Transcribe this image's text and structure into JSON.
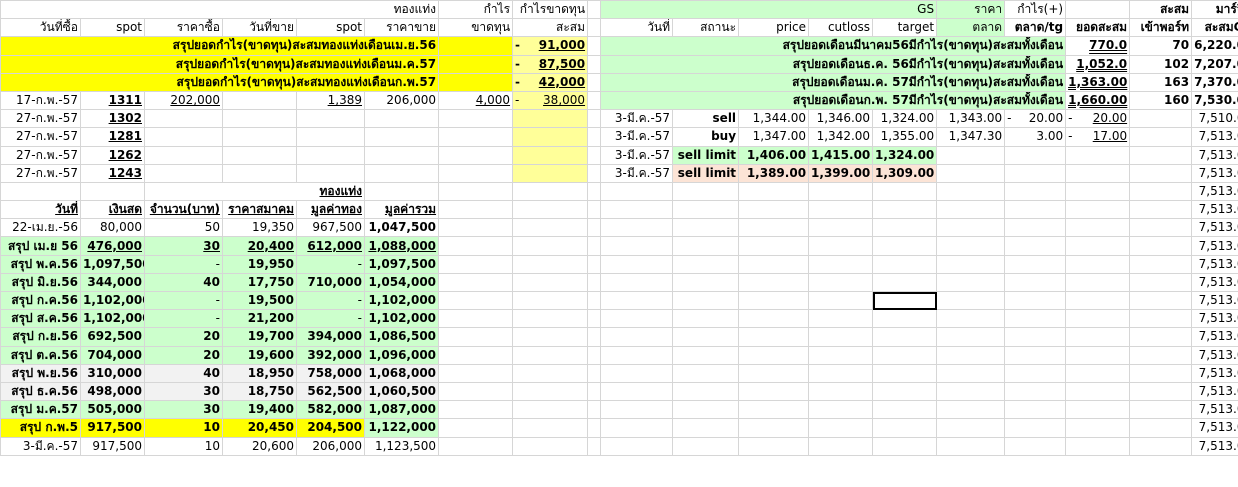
{
  "header1": {
    "gold": "ทองแท่ง",
    "profit": "กำไร",
    "profit_loss": "กำไรขาดทุน",
    "gs": "GS",
    "price": "ราคา",
    "profit_plus": "กำไร(+)",
    "accum": "สะสม",
    "margin": "มาร์จิ้น"
  },
  "header2": {
    "buy_date": "วันที่ซื้อ",
    "spot": "spot",
    "buy_price": "ราคาซื้อ",
    "sell_date": "วันที่ขาย",
    "spot2": "spot",
    "sell_price": "ราคาขาย",
    "loss": "ขาดทุน",
    "accum": "สะสม",
    "date": "วันที่",
    "status": "สถานะ",
    "price": "price",
    "cutloss": "cutloss",
    "target": "target",
    "market": "ตลาด",
    "market_tg": "ตลาด/tg",
    "total_accum": "ยอดสะสม",
    "port": "เข้าพอร์ท",
    "accum_gs": "สะสมGS"
  },
  "summary_rows": [
    {
      "label": "สรุปยอดกำไร(ขาดทุน)สะสมทองแท่งเดือนเม.ย.56",
      "dash": "-",
      "value": "91,000",
      "gs_label": "สรุปยอดเดือนมีนาคม56มีกำไร(ขาดทุน)สะสมทั้งเดือน",
      "gs_total": "770.0",
      "port": "70",
      "gs_accum": "6,220.00"
    },
    {
      "label": "สรุปยอดกำไร(ขาดทุน)สะสมทองแท่งเดือนม.ค.57",
      "dash": "-",
      "value": "87,500",
      "gs_label": "สรุปยอดเดือนธ.ค. 56มีกำไร(ขาดทุน)สะสมทั้งเดือน",
      "gs_total": "1,052.0",
      "port": "102",
      "gs_accum": "7,207.00"
    },
    {
      "label": "สรุปยอดกำไร(ขาดทุน)สะสมทองแท่งเดือนก.พ.57",
      "dash": "-",
      "value": "42,000",
      "gs_label": "สรุปยอดเดือนม.ค. 57มีกำไร(ขาดทุน)สะสมทั้งเดือน",
      "gs_total": "1,363.00",
      "port": "163",
      "gs_accum": "7,370.00"
    }
  ],
  "trade_row": {
    "buy_date": "17-ก.พ.-57",
    "spot": "1311",
    "buy_price": "202,000",
    "spot2": "1,389",
    "sell_price": "206,000",
    "profit": "4,000",
    "dash": "-",
    "accum": "38,000",
    "gs_label": "สรุปยอดเดือนก.พ. 57มีกำไร(ขาดทุน)สะสมทั้งเดือน",
    "gs_total": "1,660.00",
    "port": "160",
    "gs_accum": "7,530.00"
  },
  "pending_rows": [
    {
      "date": "27-ก.พ.-57",
      "spot": "1302"
    },
    {
      "date": "27-ก.พ.-57",
      "spot": "1281"
    },
    {
      "date": "27-ก.พ.-57",
      "spot": "1262"
    },
    {
      "date": "27-ก.พ.-57",
      "spot": "1243"
    }
  ],
  "gs_orders": [
    {
      "date": "3-มี.ค.-57",
      "status": "sell",
      "price": "1,344.00",
      "cutloss": "1,346.00",
      "target": "1,324.00",
      "market": "1,343.00",
      "dash": "-",
      "market_tg": "20.00",
      "dash2": "-",
      "total": "20.00",
      "accum": "7,510.00"
    },
    {
      "date": "3-มี.ค.-57",
      "status": "buy",
      "price": "1,347.00",
      "cutloss": "1,342.00",
      "target": "1,355.00",
      "market": "1,347.30",
      "dash": "",
      "market_tg": "3.00",
      "dash2": "-",
      "total": "17.00",
      "accum": "7,513.00"
    },
    {
      "date": "3-มี.ค.-57",
      "status": "sell limit",
      "price": "1,406.00",
      "cutloss": "1,415.00",
      "target": "1,324.00",
      "market": "",
      "dash": "",
      "market_tg": "",
      "dash2": "",
      "total": "",
      "accum": "7,513.00"
    },
    {
      "date": "3-มี.ค.-57",
      "status": "sell limit",
      "price": "1,389.00",
      "cutloss": "1,399.00",
      "target": "1,309.00",
      "market": "",
      "dash": "",
      "market_tg": "",
      "dash2": "",
      "total": "",
      "accum": "7,513.00"
    }
  ],
  "gold_section": {
    "title": "ทองแท่ง",
    "headers": [
      "วันที่",
      "เงินสด",
      "จำนวน(บาท)",
      "ราคาสมาคม",
      "มูลค่าทอง",
      "มูลค่ารวม"
    ]
  },
  "gold_rows": [
    {
      "label": "22-เม.ย.-56",
      "cash": "80,000",
      "qty": "50",
      "assoc": "19,350",
      "gold_value": "967,500",
      "total": "1,047,500"
    },
    {
      "label": "สรุป เม.ย 56",
      "cash": "476,000",
      "qty": "30",
      "assoc": "20,400",
      "gold_value": "612,000",
      "total": "1,088,000"
    },
    {
      "label": "สรุป พ.ค.56",
      "cash": "1,097,500",
      "qty": "-",
      "assoc": "19,950",
      "gold_value": "-",
      "total": "1,097,500"
    },
    {
      "label": "สรุป มิ.ย.56",
      "cash": "344,000",
      "qty": "40",
      "assoc": "17,750",
      "gold_value": "710,000",
      "total": "1,054,000"
    },
    {
      "label": "สรุป ก.ค.56",
      "cash": "1,102,000",
      "qty": "-",
      "assoc": "19,500",
      "gold_value": "-",
      "total": "1,102,000"
    },
    {
      "label": "สรุป ส.ค.56",
      "cash": "1,102,000",
      "qty": "-",
      "assoc": "21,200",
      "gold_value": "-",
      "total": "1,102,000"
    },
    {
      "label": "สรุป ก.ย.56",
      "cash": "692,500",
      "qty": "20",
      "assoc": "19,700",
      "gold_value": "394,000",
      "total": "1,086,500"
    },
    {
      "label": "สรุป ต.ค.56",
      "cash": "704,000",
      "qty": "20",
      "assoc": "19,600",
      "gold_value": "392,000",
      "total": "1,096,000"
    },
    {
      "label": "สรุป พ.ย.56",
      "cash": "310,000",
      "qty": "40",
      "assoc": "18,950",
      "gold_value": "758,000",
      "total": "1,068,000"
    },
    {
      "label": "สรุป ธ.ค.56",
      "cash": "498,000",
      "qty": "30",
      "assoc": "18,750",
      "gold_value": "562,500",
      "total": "1,060,500"
    },
    {
      "label": "สรุป ม.ค.57",
      "cash": "505,000",
      "qty": "30",
      "assoc": "19,400",
      "gold_value": "582,000",
      "total": "1,087,000"
    },
    {
      "label": "สรุป ก.พ.5",
      "cash": "917,500",
      "qty": "10",
      "assoc": "20,450",
      "gold_value": "204,500",
      "total": "1,122,000"
    },
    {
      "label": "3-มี.ค.-57",
      "cash": "917,500",
      "qty": "10",
      "assoc": "20,600",
      "gold_value": "206,000",
      "total": "1,123,500"
    }
  ],
  "margin_repeat": "7,513.00"
}
